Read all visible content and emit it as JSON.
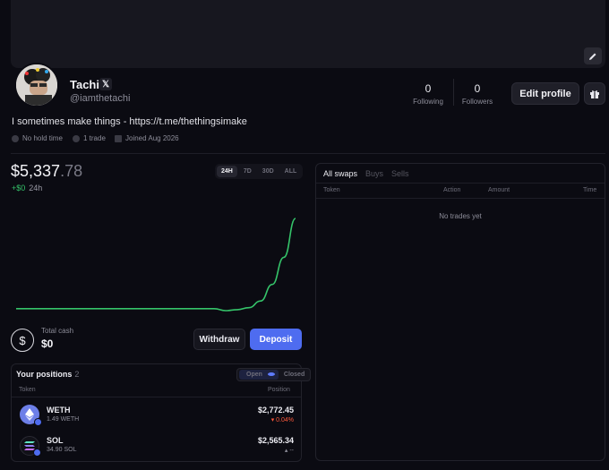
{
  "profile": {
    "name": "Tachi",
    "handle": "@iamthetachi",
    "bio": "I sometimes make things - https://t.me/thethingsimake",
    "meta": {
      "hold_time": "No hold time",
      "trades": "1 trade",
      "joined": "Joined Aug 2026"
    },
    "following": {
      "count": "0",
      "label": "Following"
    },
    "followers": {
      "count": "0",
      "label": "Followers"
    },
    "edit_label": "Edit profile"
  },
  "portfolio": {
    "balance_main": "$5,337",
    "balance_cents": ".78",
    "change": "+$0",
    "period": "24h",
    "timeframes": [
      "24H",
      "7D",
      "30D",
      "ALL"
    ],
    "active_timeframe": "24H",
    "total_cash_label": "Total cash",
    "total_cash": "$0",
    "withdraw_label": "Withdraw",
    "deposit_label": "Deposit"
  },
  "chart_data": {
    "type": "line",
    "series": [
      {
        "values": [
          5337,
          5337,
          5337,
          5337,
          5337,
          5337,
          5337,
          5337,
          5337,
          5337,
          5337,
          5337,
          5337,
          5337,
          5337,
          5337,
          5337,
          5337,
          5335,
          5336,
          5338,
          5345,
          5362,
          5390,
          5430
        ]
      }
    ],
    "line_color": "#35c46a"
  },
  "positions": {
    "title": "Your positions",
    "count": "2",
    "toggle_open": "Open",
    "toggle_closed": "Closed",
    "col_token": "Token",
    "col_position": "Position",
    "items": [
      {
        "symbol": "WETH",
        "amount": "1.49 WETH",
        "value": "$2,772.45",
        "change": "▾ 0.04%",
        "change_color": "#ff5a3c",
        "icon": "eth-icon"
      },
      {
        "symbol": "SOL",
        "amount": "34.90 SOL",
        "value": "$2,565.34",
        "change": "▴ --",
        "change_color": "#8d8d99",
        "icon": "sol-icon"
      }
    ]
  },
  "swaps": {
    "tabs": [
      "All swaps",
      "Buys",
      "Sells"
    ],
    "active_tab": "All swaps",
    "columns": {
      "token": "Token",
      "action": "Action",
      "amount": "Amount",
      "time": "Time"
    },
    "empty_text": "No trades yet"
  },
  "colors": {
    "accent": "#4e6cf0",
    "positive": "#35c46a",
    "negative": "#ff5a3c"
  }
}
